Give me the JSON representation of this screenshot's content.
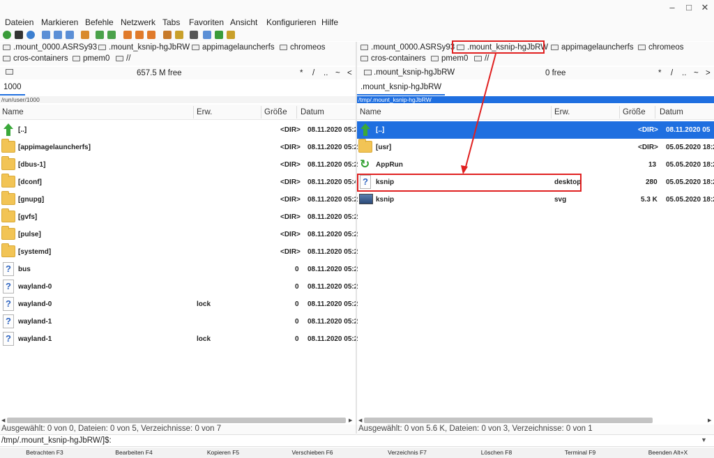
{
  "menu": [
    "Dateien",
    "Markieren",
    "Befehle",
    "Netzwerk",
    "Tabs",
    "Favoriten",
    "Ansicht",
    "Konfigurieren",
    "Hilfe"
  ],
  "left": {
    "drives_row1": [
      ".mount_0000.ASRSy93",
      ".mount_ksnip-hgJbRW",
      "appimagelauncherfs",
      "chromeos"
    ],
    "drives_row2": [
      "cros-containers",
      "pmem0",
      "//"
    ],
    "free": "657.5 M free",
    "nav": [
      "*",
      "/",
      "..",
      "~",
      "<"
    ],
    "tab": "1000",
    "path": "/run/user/1000",
    "columns": [
      "Name",
      "Erw.",
      "Größe",
      "Datum"
    ],
    "rows": [
      {
        "icon": "up",
        "name": "[..]",
        "ext": "",
        "size": "<DIR>",
        "date": "08.11.2020 05:2"
      },
      {
        "icon": "folder",
        "name": "[appimagelauncherfs]",
        "ext": "",
        "size": "<DIR>",
        "date": "08.11.2020 05:2"
      },
      {
        "icon": "folder",
        "name": "[dbus-1]",
        "ext": "",
        "size": "<DIR>",
        "date": "08.11.2020 05:2"
      },
      {
        "icon": "folder",
        "name": "[dconf]",
        "ext": "",
        "size": "<DIR>",
        "date": "08.11.2020 05:4"
      },
      {
        "icon": "folder",
        "name": "[gnupg]",
        "ext": "",
        "size": "<DIR>",
        "date": "08.11.2020 05:2"
      },
      {
        "icon": "folder",
        "name": "[gvfs]",
        "ext": "",
        "size": "<DIR>",
        "date": "08.11.2020 05:2"
      },
      {
        "icon": "folder",
        "name": "[pulse]",
        "ext": "",
        "size": "<DIR>",
        "date": "08.11.2020 05:2"
      },
      {
        "icon": "folder",
        "name": "[systemd]",
        "ext": "",
        "size": "<DIR>",
        "date": "08.11.2020 05:2"
      },
      {
        "icon": "doc",
        "name": "bus",
        "ext": "",
        "size": "0",
        "date": "08.11.2020 05:2"
      },
      {
        "icon": "doc",
        "name": "wayland-0",
        "ext": "",
        "size": "0",
        "date": "08.11.2020 05:2"
      },
      {
        "icon": "doc",
        "name": "wayland-0",
        "ext": "lock",
        "size": "0",
        "date": "08.11.2020 05:2"
      },
      {
        "icon": "doc",
        "name": "wayland-1",
        "ext": "",
        "size": "0",
        "date": "08.11.2020 05:2"
      },
      {
        "icon": "doc",
        "name": "wayland-1",
        "ext": "lock",
        "size": "0",
        "date": "08.11.2020 05:2"
      }
    ],
    "status": "Ausgewählt: 0 von 0, Dateien: 0 von 5, Verzeichnisse: 0 von 7"
  },
  "right": {
    "drives_row1": [
      ".mount_0000.ASRSy93",
      ".mount_ksnip-hgJbRW",
      "appimagelauncherfs",
      "chromeos"
    ],
    "drives_row2": [
      "cros-containers",
      "pmem0",
      "//"
    ],
    "current_drive": ".mount_ksnip-hgJbRW",
    "free": "0 free",
    "nav": [
      "*",
      "/",
      "..",
      "~",
      ">"
    ],
    "tab": ".mount_ksnip-hgJbRW",
    "path": "/tmp/.mount_ksnip-hgJbRW",
    "columns": [
      "Name",
      "Erw.",
      "Größe",
      "Datum"
    ],
    "rows": [
      {
        "icon": "up",
        "name": "[..]",
        "ext": "",
        "size": "<DIR>",
        "date": "08.11.2020 05",
        "selected": true
      },
      {
        "icon": "folder",
        "name": "[usr]",
        "ext": "",
        "size": "<DIR>",
        "date": "05.05.2020 18:2"
      },
      {
        "icon": "run",
        "name": "AppRun",
        "ext": "",
        "size": "13",
        "date": "05.05.2020 18:2"
      },
      {
        "icon": "doc",
        "name": "ksnip",
        "ext": "desktop",
        "size": "280",
        "date": "05.05.2020 18:2"
      },
      {
        "icon": "img",
        "name": "ksnip",
        "ext": "svg",
        "size": "5.3 K",
        "date": "05.05.2020 18:2"
      }
    ],
    "status": "Ausgewählt: 0 von 5.6 K, Dateien: 0 von 3, Verzeichnisse: 0 von 1"
  },
  "cmdline": "/tmp/.mount_ksnip-hgJbRW/]$:",
  "fkeys": [
    "Betrachten F3",
    "Bearbeiten F4",
    "Kopieren F5",
    "Verschieben F6",
    "Verzeichnis F7",
    "Löschen F8",
    "Terminal F9",
    "Beenden Alt+X"
  ],
  "colors": {
    "selection": "#1f6fe0",
    "highlight": "#e02020",
    "folder": "#f2c455"
  }
}
